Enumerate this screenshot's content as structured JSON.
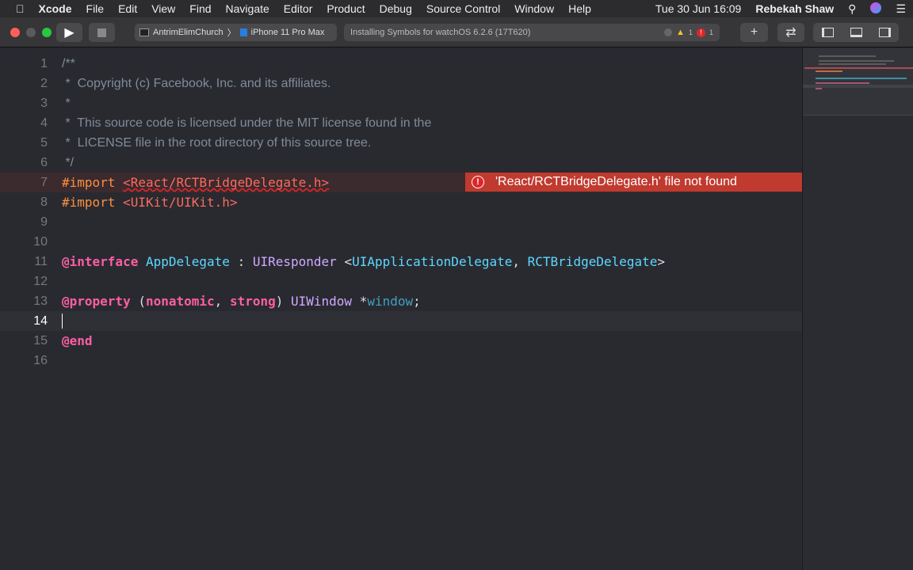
{
  "menubar": {
    "app": "Xcode",
    "items": [
      "File",
      "Edit",
      "View",
      "Find",
      "Navigate",
      "Editor",
      "Product",
      "Debug",
      "Source Control",
      "Window",
      "Help"
    ],
    "clock": "Tue 30 Jun  16:09",
    "user": "Rebekah Shaw"
  },
  "toolbar": {
    "project": "AntrimElimChurch",
    "device": "iPhone 11 Pro Max",
    "activity": "Installing Symbols for watchOS 6.2.6 (17T620)",
    "warnings": "1",
    "errors": "1"
  },
  "editor": {
    "lines": [
      "1",
      "2",
      "3",
      "4",
      "5",
      "6",
      "7",
      "8",
      "9",
      "10",
      "11",
      "12",
      "13",
      "14",
      "15",
      "16"
    ],
    "c1": "/**",
    "c2": " *  Copyright (c) Facebook, Inc. and its affiliates.",
    "c3": " *",
    "c4": " *  This source code is licensed under the MIT license found in the",
    "c5": " *  LICENSE file in the root directory of this source tree.",
    "c6": " */",
    "import": "#import",
    "h7": "<React/RCTBridgeDelegate.h>",
    "h8": "<UIKit/UIKit.h>",
    "interface": "@interface",
    "appdelegate": "AppDelegate",
    "colon": " : ",
    "uiresponder": "UIResponder",
    "lt": " <",
    "uiappdel": "UIApplicationDelegate",
    "comma": ", ",
    "rctbd": "RCTBridgeDelegate",
    "gt": ">",
    "property": "@property",
    "lp": " (",
    "nonatomic": "nonatomic",
    "strong": "strong",
    "rp": ") ",
    "uiwindow": "UIWindow",
    "star": " *",
    "window": "window",
    "semi": ";",
    "end": "@end",
    "error": "'React/RCTBridgeDelegate.h' file not found"
  }
}
